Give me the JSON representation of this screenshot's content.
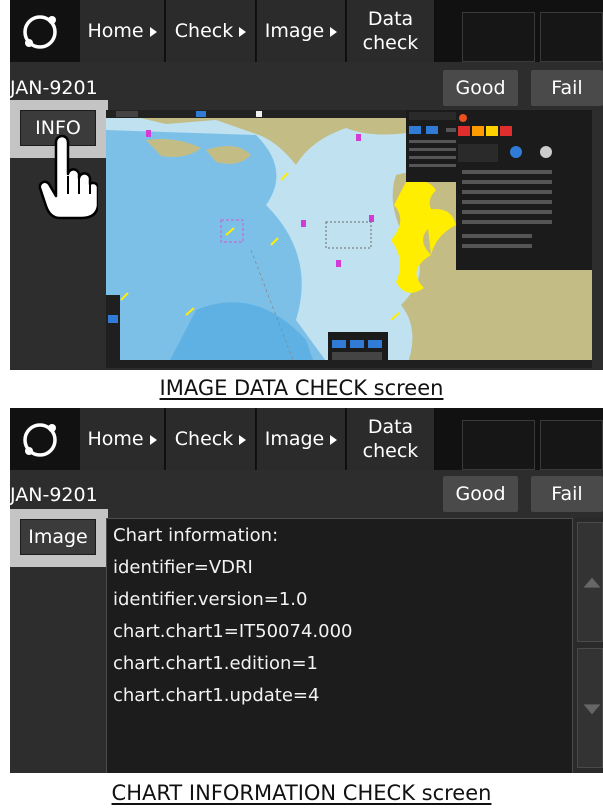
{
  "image_data_check_screen": {
    "nav": {
      "home_label": "Home",
      "check_label": "Check",
      "image_label": "Image",
      "data_check_line1": "Data",
      "data_check_line2": "check"
    },
    "device_name": "JAN-9201",
    "good_label": "Good",
    "fail_label": "Fail",
    "side_button_label": "INFO",
    "caption": "IMAGE DATA CHECK screen"
  },
  "chart_information_check_screen": {
    "nav": {
      "home_label": "Home",
      "check_label": "Check",
      "image_label": "Image",
      "data_check_line1": "Data",
      "data_check_line2": "check"
    },
    "device_name": "JAN-9201",
    "good_label": "Good",
    "fail_label": "Fail",
    "side_button_label": "Image",
    "info_lines": [
      "Chart information:",
      "identifier=VDRI",
      "identifier.version=1.0",
      "chart.chart1=IT50074.000",
      "chart.chart1.edition=1",
      "chart.chart1.update=4"
    ],
    "caption": "CHART INFORMATION CHECK screen"
  },
  "colors": {
    "topbar": "#111111",
    "nav_button": "#2b2b2b",
    "screen_bg": "#2d2d2d",
    "sea_light": "#bfe1f0",
    "sea_deep": "#5fb1e4",
    "land": "#c3bd85",
    "coastline_highlight": "#ffee00",
    "highlight_frame": "#c4c4c4"
  },
  "icons": {
    "logo": "ring-logo-icon",
    "nav_arrow": "triangle-right-icon",
    "pointer": "hand-pointer-icon",
    "scroll_up": "triangle-up-icon",
    "scroll_down": "triangle-down-icon"
  }
}
